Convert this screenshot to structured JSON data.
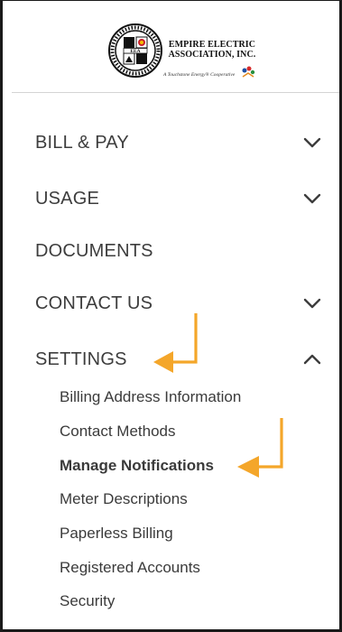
{
  "logo": {
    "title_line1": "EMPIRE ELECTRIC",
    "title_line2": "ASSOCIATION, INC.",
    "seal_text": "EEA",
    "tagline": "A Touchstone Energy® Cooperative"
  },
  "menu": {
    "items": [
      {
        "label": "BILL & PAY",
        "chevron": "chevron-down-icon"
      },
      {
        "label": "USAGE",
        "chevron": "chevron-down-icon"
      },
      {
        "label": "DOCUMENTS",
        "chevron": ""
      },
      {
        "label": "CONTACT US",
        "chevron": "chevron-down-icon"
      },
      {
        "label": "SETTINGS",
        "chevron": "chevron-up-icon"
      }
    ],
    "settings_sub": [
      "Billing Address Information",
      "Contact Methods",
      "Manage Notifications",
      "Meter Descriptions",
      "Paperless Billing",
      "Registered Accounts",
      "Security"
    ],
    "active_sub": "Manage Notifications"
  },
  "colors": {
    "arrow": "#f4a62a",
    "text": "#3d3d3d",
    "chevron": "#3d3d3d"
  }
}
